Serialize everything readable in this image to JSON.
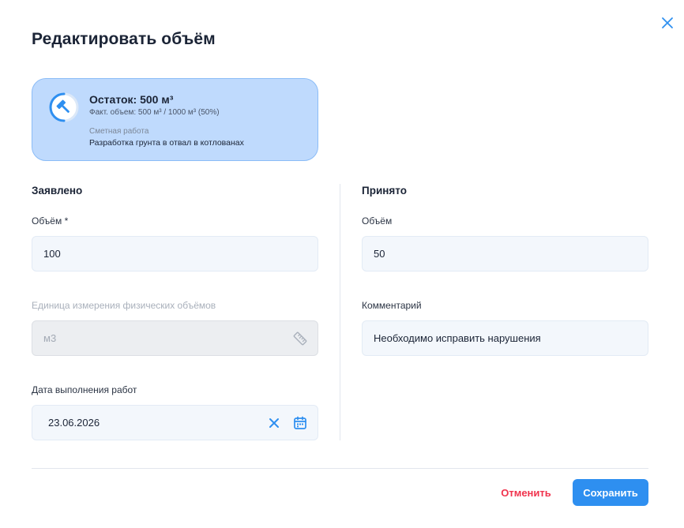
{
  "dialog": {
    "title": "Редактировать объём"
  },
  "summary": {
    "remaining": "Остаток: 500 м³",
    "actual": "Факт. объем: 500 м³ / 1000 м³ (50%)",
    "progress_fraction": 0.5,
    "estimate_label": "Сметная работа",
    "estimate_value": "Разработка грунта в отвал в котлованах",
    "icon": "hammer-icon"
  },
  "declared": {
    "section_title": "Заявлено",
    "volume_label": "Объём *",
    "volume_value": "100",
    "unit_label": "Единица измерения физических объёмов",
    "unit_value": "м3",
    "date_label": "Дата выполнения работ",
    "date_value": "23.06.2026"
  },
  "accepted": {
    "section_title": "Принято",
    "volume_label": "Объём",
    "volume_value": "50",
    "comment_label": "Комментарий",
    "comment_value": "Необходимо исправить нарушения"
  },
  "actions": {
    "cancel_label": "Отменить",
    "save_label": "Сохранить"
  },
  "colors": {
    "accent": "#2e8ff0",
    "danger": "#f0334d",
    "card_bg": "#bfdafd",
    "input_bg": "#f3f7fc"
  }
}
